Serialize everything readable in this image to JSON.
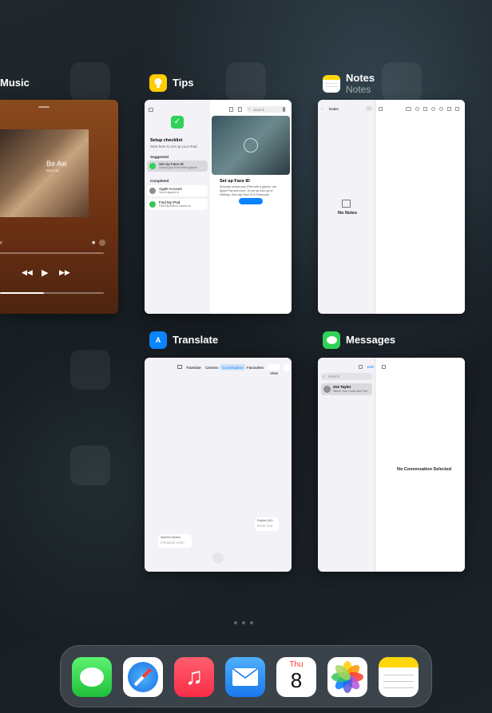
{
  "switcher": {
    "apps": [
      {
        "key": "music",
        "title": "Music",
        "subtitle": ""
      },
      {
        "key": "tips",
        "title": "Tips",
        "subtitle": ""
      },
      {
        "key": "notes",
        "title": "Notes",
        "subtitle": "Notes"
      },
      {
        "key": "translate",
        "title": "Translate",
        "subtitle": ""
      },
      {
        "key": "messages",
        "title": "Messages",
        "subtitle": ""
      }
    ]
  },
  "music": {
    "track_title": "Be Aw",
    "track_sub": "Beyond"
  },
  "tips": {
    "search_placeholder": "Search",
    "setup_title": "Setup checklist",
    "setup_sub": "Start here to set up your iPad.",
    "suggested_header": "Suggested",
    "suggested_item": "Set Up Face ID",
    "suggested_item_sub": "Unlock your iPad with a glance",
    "completed_header": "Completed",
    "completed_items": [
      {
        "title": "Apple Account",
        "sub": "You're signed in"
      },
      {
        "title": "Find My iPad",
        "sub": "Find My iPad is turned on"
      }
    ],
    "detail_title": "Set up Face ID",
    "detail_body": "Securely unlock your iPad with a glance, use Apple Pay and more. To set up now, go to Settings, then tap Face ID & Passcode.",
    "detail_button": "Set Up Face ID"
  },
  "notes": {
    "sidebar_title": "Notes",
    "empty_label": "No Notes"
  },
  "translate": {
    "tabs": [
      "Translate",
      "Camera",
      "Conversation",
      "Favourites"
    ],
    "active_tab": "Conversation",
    "view_label": "View",
    "bubble_right_lang": "English (UK)",
    "bubble_right_placeholder": "Enter text",
    "bubble_left_lang": "Spanish (Spain)",
    "bubble_left_placeholder": "Introducir texto"
  },
  "messages": {
    "edit_label": "Edit",
    "search_placeholder": "Search",
    "conversation_name": "Zoe Taylor",
    "conversation_preview": "Where Your Home and Tree",
    "avatar_initials": "ZT",
    "empty_label": "No Conversation Selected"
  },
  "dock": {
    "apps": [
      {
        "name": "Messages",
        "icon": "messages-icon"
      },
      {
        "name": "Safari",
        "icon": "safari-icon"
      },
      {
        "name": "Music",
        "icon": "music-icon"
      },
      {
        "name": "Mail",
        "icon": "mail-icon"
      },
      {
        "name": "Calendar",
        "icon": "calendar-icon"
      },
      {
        "name": "Photos",
        "icon": "photos-icon"
      },
      {
        "name": "Notes",
        "icon": "notes-icon"
      }
    ],
    "calendar_day": "Thu",
    "calendar_date": "8"
  },
  "colors": {
    "accent_blue": "#0a84ff",
    "messages_green": "#30d158",
    "tips_yellow": "#ffcc00",
    "music_red": "#fa2d48"
  }
}
